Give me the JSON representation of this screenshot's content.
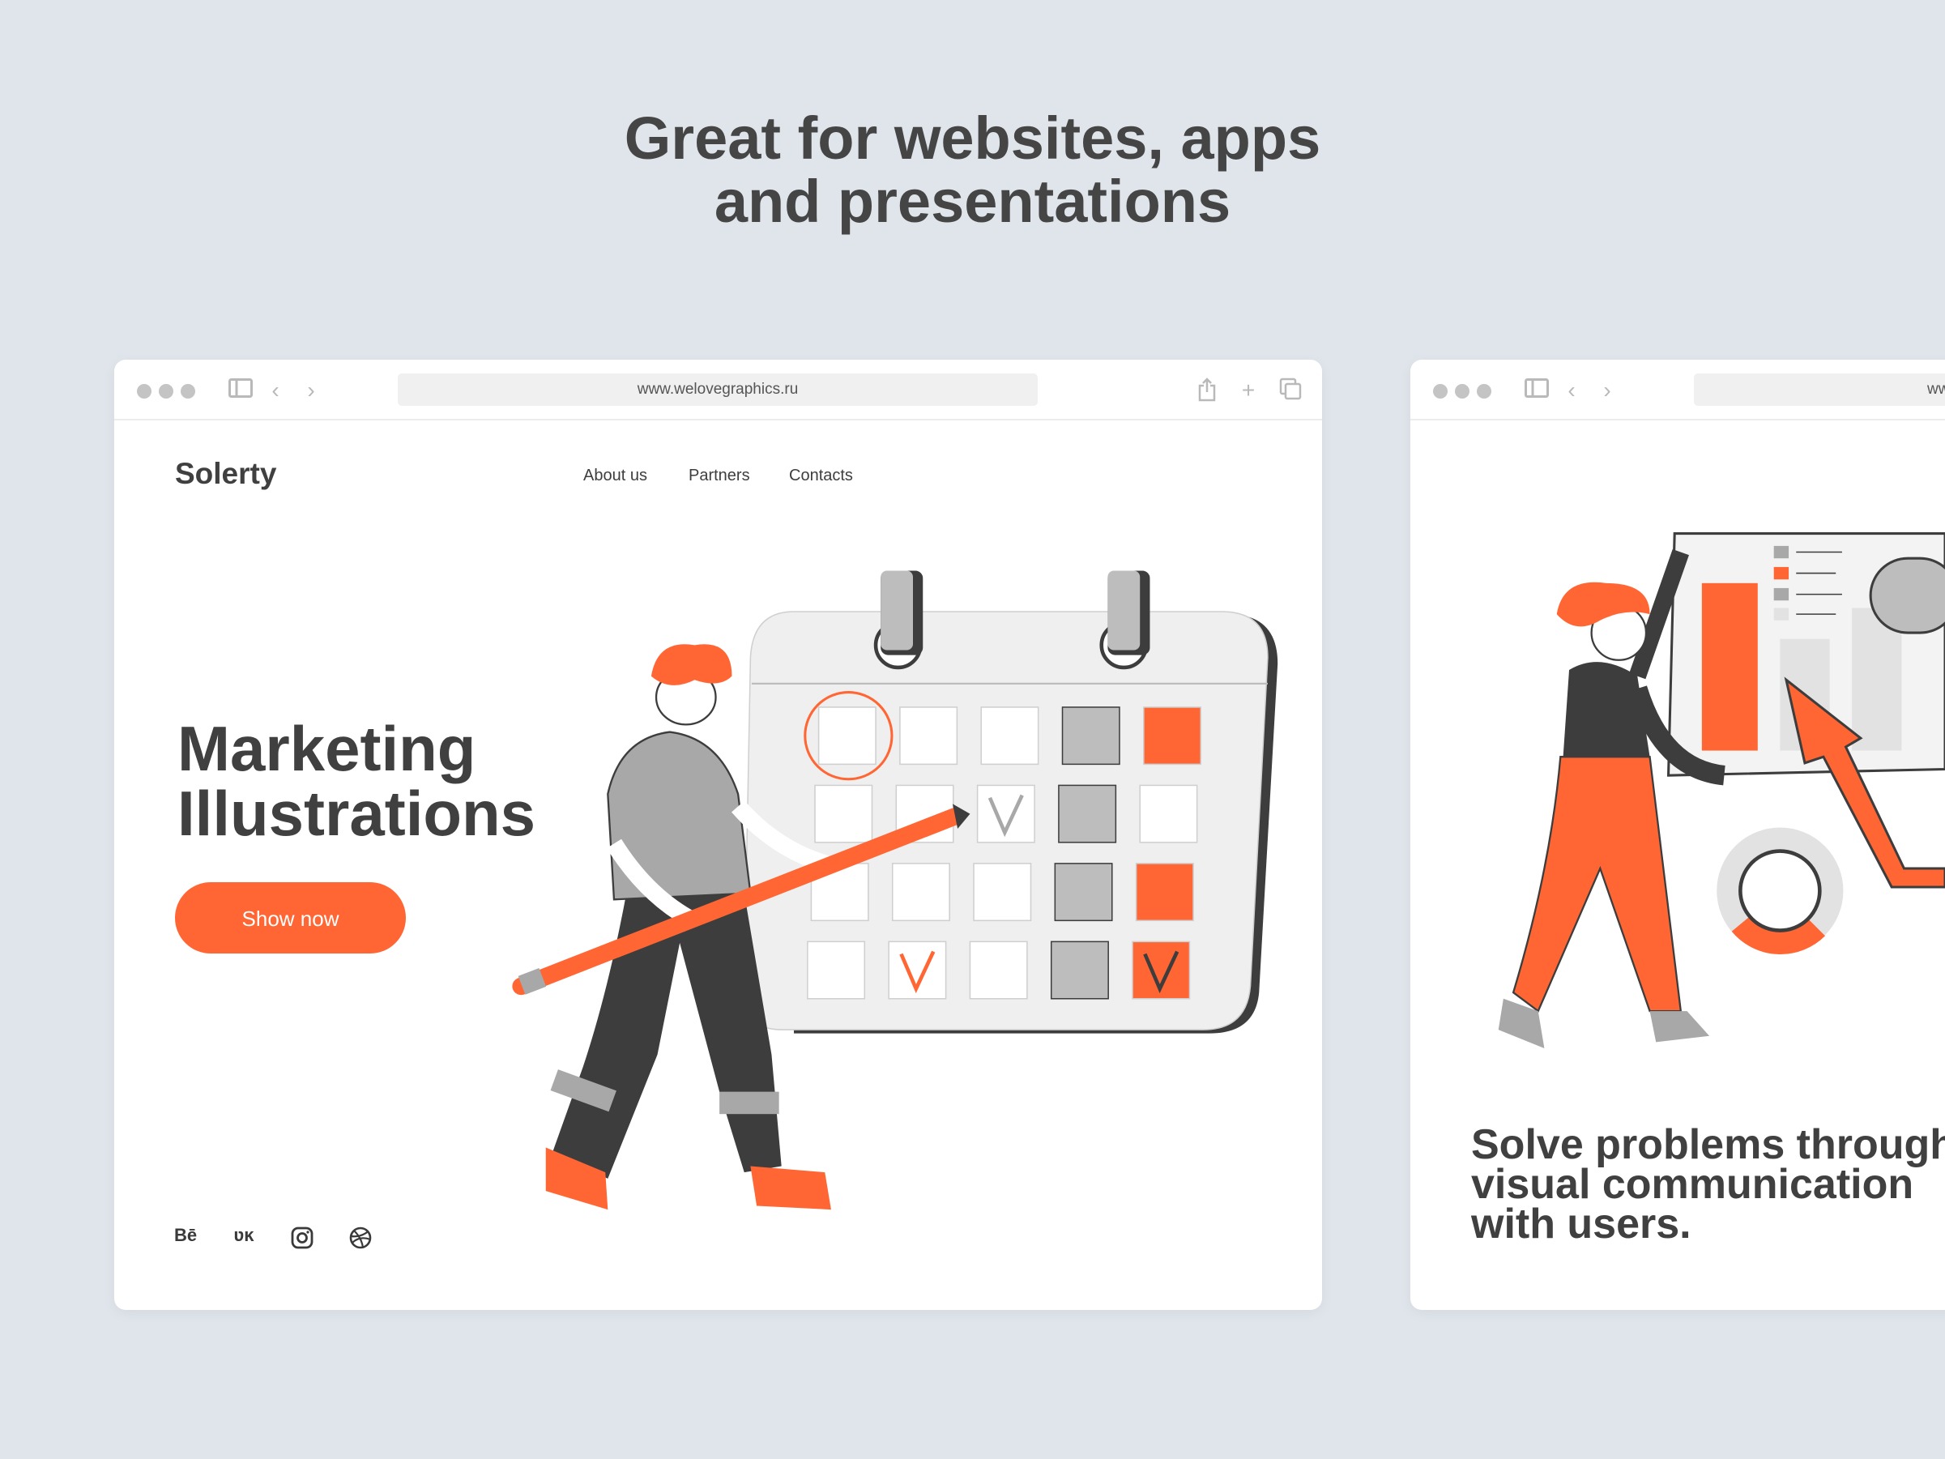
{
  "headline": {
    "line1": "Great for websites, apps",
    "line2": "and presentations"
  },
  "colors": {
    "accent": "#ff6633",
    "background": "#dfe5eb",
    "text": "#434343"
  },
  "left_window": {
    "url": "www.welovegraphics.ru",
    "toolbar_icons": [
      "sidebar-icon",
      "back-icon",
      "forward-icon",
      "share-icon",
      "new-tab-icon",
      "tabs-icon"
    ],
    "logo": "Solerty",
    "nav": [
      {
        "label": "About us"
      },
      {
        "label": "Partners"
      },
      {
        "label": "Contacts"
      }
    ],
    "hero_line1": "Marketing",
    "hero_line2": "Illustrations",
    "button": "Show now",
    "social": [
      {
        "icon": "behance-icon",
        "label": "Bē"
      },
      {
        "icon": "vk-icon",
        "label": "ʋĸ"
      },
      {
        "icon": "instagram-icon"
      },
      {
        "icon": "dribbble-icon"
      }
    ]
  },
  "right_window": {
    "url_partial": "ww",
    "text_line1": "Solve problems through",
    "text_line2": "visual communication",
    "text_line3": "with users."
  }
}
